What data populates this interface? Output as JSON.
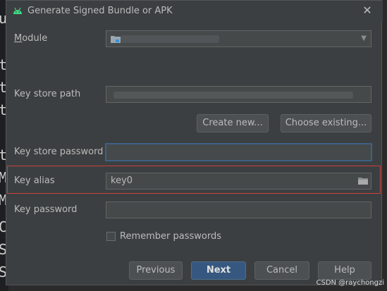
{
  "window": {
    "title": "Generate Signed Bundle or APK",
    "close_glyph": "✕"
  },
  "background_editor": {
    "letters": [
      "u",
      "t",
      "t",
      "t",
      "t",
      "M",
      "M",
      "C",
      "S",
      "S"
    ]
  },
  "form": {
    "module": {
      "label": "Module",
      "value": "...android.app"
    },
    "key_store_path": {
      "label": "Key store path",
      "value": ""
    },
    "create_new_label": "Create new...",
    "choose_existing_label": "Choose existing...",
    "key_store_password": {
      "label": "Key store password",
      "value": ""
    },
    "key_alias": {
      "label": "Key alias",
      "value": "key0"
    },
    "key_password": {
      "label": "Key password",
      "value": ""
    },
    "remember_passwords": {
      "label": "Remember passwords",
      "checked": false
    }
  },
  "buttons": {
    "previous": "Previous",
    "next": "Next",
    "cancel": "Cancel",
    "help": "Help"
  },
  "watermark": "CSDN @raychongzi",
  "colors": {
    "highlight_red": "#c9403c",
    "android_green": "#3ddc84",
    "focus_blue": "#3d6185",
    "primary_blue": "#365880"
  },
  "icons": [
    "android-icon",
    "close-icon",
    "folder-icon",
    "chevron-down-icon"
  ]
}
